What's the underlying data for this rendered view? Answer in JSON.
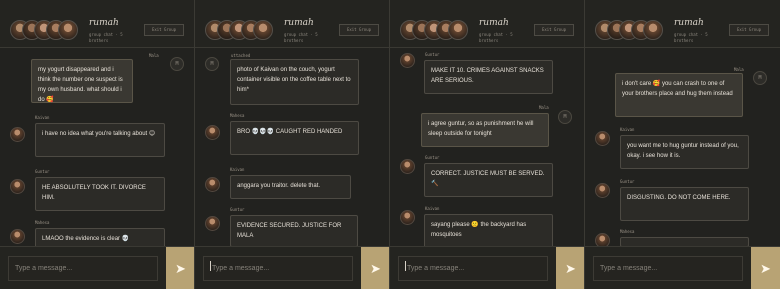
{
  "header": {
    "title": "rumah",
    "subtitle": "group chat · 5 brothers",
    "exit_label": "Exit Group"
  },
  "input": {
    "placeholder": "Type a message..."
  },
  "send": {
    "glyph": "➤"
  },
  "panels": [
    {
      "messages": [
        {
          "sender": "Mala",
          "text": "my yogurt disappeared and i think the number one suspect is my own husband. what should i do 🥰",
          "self": true
        },
        {
          "sender": "Kaivan",
          "text": "i have no idea what you're talking about 😊",
          "self": false
        },
        {
          "sender": "Guntur",
          "text": "HE ABSOLUTELY TOOK IT. DIVORCE HIM.",
          "self": false
        },
        {
          "sender": "Mahesa",
          "text": "LMAOO the evidence is clear 💀",
          "self": false
        }
      ]
    },
    {
      "messages": [
        {
          "sender": "uttached",
          "text": "photo of Kaivan on the couch, yogurt container visible on the coffee table next to him*",
          "self": false
        },
        {
          "sender": "Mahesa",
          "text": "BRO 💀💀💀 CAUGHT RED HANDED",
          "self": false
        },
        {
          "sender": "Kaivan",
          "text": "anggara you traitor. delete that.",
          "self": false
        },
        {
          "sender": "Guntur",
          "text": "EVIDENCE SECURED. JUSTICE FOR MALA",
          "self": false
        }
      ]
    },
    {
      "messages": [
        {
          "sender": "Guntur",
          "text": "MAKE IT 10. CRIMES AGAINST SNACKS ARE SERIOUS.",
          "self": false
        },
        {
          "sender": "Mala",
          "text": "i agree guntur, so as punishment he will sleep outside for tonight",
          "self": true
        },
        {
          "sender": "Guntur",
          "text": "CORRECT. JUSTICE MUST BE SERVED. 🔨",
          "self": false
        },
        {
          "sender": "Kaivan",
          "text": "sayang please 🙁 the backyard has mosquitoes",
          "self": false
        }
      ]
    },
    {
      "messages": [
        {
          "sender": "Mala",
          "text": "i don't care 🥰 you can crash to one of your brothers place and hug them instead",
          "self": true
        },
        {
          "sender": "Kaivan",
          "text": "you want me to hug guntur instead of you, okay. i see how it is.",
          "self": false
        },
        {
          "sender": "Guntur",
          "text": "DISGUSTING. DO NOT COME HERE.",
          "self": false
        },
        {
          "sender": "Mahesa",
          "text": "",
          "self": false
        }
      ]
    }
  ]
}
